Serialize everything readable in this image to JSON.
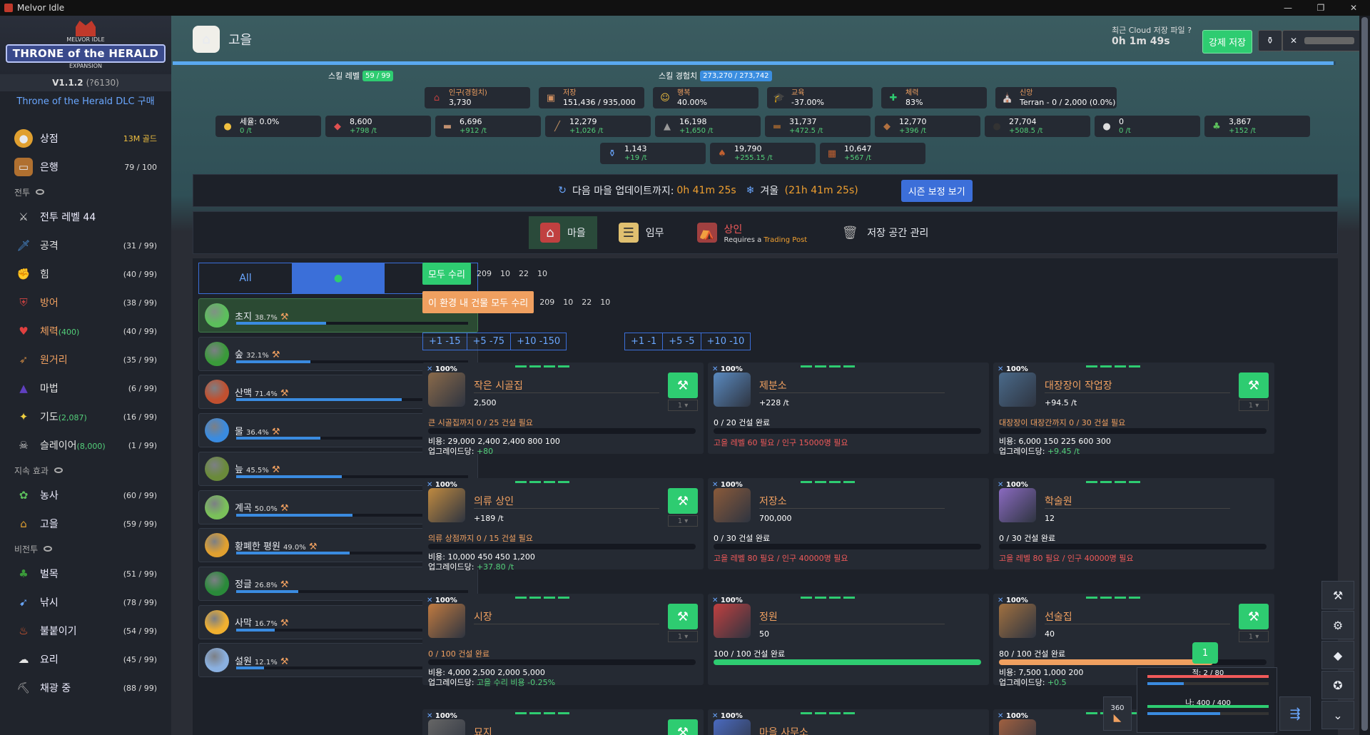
{
  "window": {
    "title": "Melvor Idle"
  },
  "sidebar": {
    "logo": {
      "top": "MELVOR IDLE",
      "title": "THRONE of the HERALD",
      "bottom": "EXPANSION"
    },
    "version": "V1.1.2",
    "version_build": "(?6130)",
    "dlc_link": "Throne of the Herald DLC 구매",
    "shop": {
      "label": "상점",
      "gold": "13M 골드"
    },
    "bank": {
      "label": "은행",
      "count": "79 / 100"
    },
    "cat_combat": "전투",
    "combat_level": "전투 레벨 44",
    "combat_items": [
      {
        "label": "공격",
        "extra": "",
        "level": "(31 / 99)",
        "color": "#e5e5e5"
      },
      {
        "label": "힘",
        "extra": "",
        "level": "(40 / 99)",
        "color": "#e5e5e5"
      },
      {
        "label": "방어",
        "extra": "",
        "level": "(38 / 99)",
        "color": "#f0a060"
      },
      {
        "label": "체력",
        "extra": "(400)",
        "level": "(40 / 99)",
        "color": "#f0a060"
      },
      {
        "label": "원거리",
        "extra": "",
        "level": "(35 / 99)",
        "color": "#f0a060"
      },
      {
        "label": "마법",
        "extra": "",
        "level": "(6 / 99)",
        "color": "#e5e5e5"
      },
      {
        "label": "기도",
        "extra": "(2,087)",
        "level": "(16 / 99)",
        "color": "#e5e5e5"
      },
      {
        "label": "슬레이어",
        "extra": "(8,000)",
        "level": "(1 / 99)",
        "color": "#e5e5e5"
      }
    ],
    "cat_passive": "지속 효과",
    "passive_items": [
      {
        "label": "농사",
        "level": "(60 / 99)"
      },
      {
        "label": "고을",
        "level": "(59 / 99)"
      }
    ],
    "cat_noncombat": "비전투",
    "noncombat_items": [
      {
        "label": "벌목",
        "level": "(51 / 99)"
      },
      {
        "label": "낚시",
        "level": "(78 / 99)"
      },
      {
        "label": "불붙이기",
        "level": "(54 / 99)"
      },
      {
        "label": "요리",
        "level": "(45 / 99)"
      },
      {
        "label": "채광 중",
        "level": "(88 / 99)"
      }
    ]
  },
  "header": {
    "title": "고을",
    "cloud_label": "최근 Cloud 저장 파일",
    "cloud_time": "0h 1m 49s",
    "force_save": "강제 저장"
  },
  "skill": {
    "level_label": "스킬 레벨",
    "level": "59 / 99",
    "xp_label": "스킬 경험치",
    "xp": "273,270 / 273,742",
    "xp_fraction": 0.998
  },
  "stats": [
    {
      "label": "인구(경험치)",
      "value": "3,730",
      "color": "#f0a060"
    },
    {
      "label": "저장",
      "value": "151,436 / 935,000",
      "color": "#f0a060"
    },
    {
      "label": "행복",
      "value": "40.00%",
      "color": "#f0a060"
    },
    {
      "label": "교육",
      "value": "-37.00%",
      "color": "#f0a060"
    },
    {
      "label": "체력",
      "value": "83%",
      "color": "#f0a060"
    },
    {
      "label": "신앙",
      "value": "Terran - 0 / 2,000 (0.0%)",
      "color": "#f0a060"
    }
  ],
  "resources": [
    {
      "name": "gold",
      "value": "세율: 0.0%",
      "rate": "0 /t"
    },
    {
      "name": "food",
      "value": "8,600",
      "rate": "+798 /t"
    },
    {
      "name": "wood",
      "value": "6,696",
      "rate": "+912 /t"
    },
    {
      "name": "planks",
      "value": "12,279",
      "rate": "+1,026 /t"
    },
    {
      "name": "stone",
      "value": "16,198",
      "rate": "+1,650 /t"
    },
    {
      "name": "planks2",
      "value": "31,737",
      "rate": "+472.5 /t"
    },
    {
      "name": "leather",
      "value": "12,770",
      "rate": "+396 /t"
    },
    {
      "name": "coal",
      "value": "27,704",
      "rate": "+508.5 /t"
    },
    {
      "name": "bar",
      "value": "0",
      "rate": "0 /t"
    },
    {
      "name": "herbs",
      "value": "3,867",
      "rate": "+152 /t"
    },
    {
      "name": "potions",
      "value": "1,143",
      "rate": "+19 /t"
    },
    {
      "name": "clothing",
      "value": "19,790",
      "rate": "+255.15 /t"
    },
    {
      "name": "bricks",
      "value": "10,647",
      "rate": "+567 /t"
    }
  ],
  "update": {
    "label": "다음 마을 업데이트까지:",
    "time": "0h 41m 25s",
    "season_label": "겨울",
    "season_time": "(21h 41m 25s)",
    "season_btn": "시즌 보정 보기"
  },
  "tabs": [
    {
      "label": "마을",
      "sub": ""
    },
    {
      "label": "임무",
      "sub": ""
    },
    {
      "label": "상인",
      "sub": "Requires a",
      "sub2": "Trading Post"
    },
    {
      "label": "저장 공간 관리",
      "sub": ""
    }
  ],
  "filter": {
    "all": "All"
  },
  "biomes": [
    {
      "name": "초지",
      "pct": "38.7%",
      "fill": 0.387,
      "color": "#5cbf5c"
    },
    {
      "name": "숲",
      "pct": "32.1%",
      "fill": 0.321,
      "color": "#3a9a3a"
    },
    {
      "name": "산맥",
      "pct": "71.4%",
      "fill": 0.714,
      "color": "#c05030"
    },
    {
      "name": "물",
      "pct": "36.4%",
      "fill": 0.364,
      "color": "#3a8be0"
    },
    {
      "name": "늪",
      "pct": "45.5%",
      "fill": 0.455,
      "color": "#6a8a3a"
    },
    {
      "name": "계곡",
      "pct": "50.0%",
      "fill": 0.5,
      "color": "#7ac05a"
    },
    {
      "name": "황폐한 평원",
      "pct": "49.0%",
      "fill": 0.49,
      "color": "#e0a030"
    },
    {
      "name": "정글",
      "pct": "26.8%",
      "fill": 0.268,
      "color": "#2a8a3a"
    },
    {
      "name": "사막",
      "pct": "16.7%",
      "fill": 0.167,
      "color": "#f0b030"
    },
    {
      "name": "설원",
      "pct": "12.1%",
      "fill": 0.121,
      "color": "#8ab0e0"
    }
  ],
  "repair_all": {
    "label": "모두 수리",
    "costs": [
      "209",
      "10",
      "22",
      "10"
    ]
  },
  "repair_biome": {
    "label": "이 환경 내 건물 모두 수리",
    "costs": [
      "209",
      "10",
      "22",
      "10"
    ]
  },
  "adjust1": [
    "+1  -15",
    "+5  -75",
    "+10  -150"
  ],
  "adjust2": [
    "+1  -1",
    "+5  -5",
    "+10  -10"
  ],
  "cards": [
    {
      "pct": "100%",
      "name": "작은 시골집",
      "stat": "2,500",
      "prog": "큰 시골집까지 0 / 25 건설 필요",
      "fill": 0,
      "cost": "비용: 29,000  2,400  2,400  800  100",
      "upg": "업그레이드당:",
      "upg_v": "+80",
      "req": "",
      "upgrade": true
    },
    {
      "pct": "100%",
      "name": "제분소",
      "stat": "+228 /t",
      "prog": "0 / 20 건설 완료",
      "fill": 0,
      "cost": "",
      "upg": "",
      "upg_v": "",
      "req": "고을 레벨 60 필요 / 인구 15000명 필요",
      "upgrade": false
    },
    {
      "pct": "100%",
      "name": "대장장이 작업장",
      "stat": "+94.5 /t",
      "prog": "대장장이 대장간까지 0 / 30 건설 필요",
      "fill": 0,
      "cost": "비용: 6,000  150  225  600  300",
      "upg": "업그레이드당:",
      "upg_v": "+9.45 /t",
      "req": "",
      "upgrade": true
    },
    {
      "pct": "100%",
      "name": "의류 상인",
      "stat": "+189 /t",
      "prog": "의류 상점까지 0 / 15 건설 필요",
      "fill": 0,
      "cost": "비용: 10,000  450  450  1,200",
      "upg": "업그레이드당:",
      "upg_v": "+37.80 /t",
      "req": "",
      "upgrade": true
    },
    {
      "pct": "100%",
      "name": "저장소",
      "stat": "700,000",
      "prog": "0 / 30 건설 완료",
      "fill": 0,
      "cost": "",
      "upg": "",
      "upg_v": "",
      "req": "고을 레벨 80 필요 / 인구 40000명 필요",
      "upgrade": false
    },
    {
      "pct": "100%",
      "name": "학술원",
      "stat": "12",
      "prog": "0 / 30 건설 완료",
      "fill": 0,
      "cost": "",
      "upg": "",
      "upg_v": "",
      "req": "고을 레벨 80 필요 / 인구 40000명 필요",
      "upgrade": false
    },
    {
      "pct": "100%",
      "name": "시장",
      "stat": "",
      "prog": "0 / 100 건설 완료",
      "fill": 0,
      "cost": "비용: 4,000  2,500  2,000  5,000",
      "upg": "업그레이드당:",
      "upg_v": "고을 수리 비용 -0.25%",
      "req": "",
      "upgrade": true
    },
    {
      "pct": "100%",
      "name": "정원",
      "stat": "50",
      "prog": "100 / 100 건설 완료",
      "fill": 1,
      "cost": "",
      "upg": "",
      "upg_v": "",
      "req": "",
      "upgrade": false
    },
    {
      "pct": "100%",
      "name": "선술집",
      "stat": "40",
      "prog": "80 / 100 건설 완료",
      "fill": 0.8,
      "cost": "비용: 7,500  1,000  200",
      "upg": "업그레이드당:",
      "upg_v": "+0.5",
      "req": "",
      "upgrade": true
    },
    {
      "pct": "100%",
      "name": "묘지",
      "stat": "",
      "prog": "",
      "fill": 0,
      "cost": "",
      "upg": "",
      "upg_v": "",
      "req": "",
      "upgrade": true
    },
    {
      "pct": "100%",
      "name": "마을 사무소",
      "stat": "",
      "prog": "",
      "fill": 0,
      "cost": "",
      "upg": "",
      "upg_v": "",
      "req": "",
      "upgrade": false
    },
    {
      "pct": "100%",
      "name": "",
      "stat": "",
      "prog": "",
      "fill": 0,
      "cost": "",
      "upg": "",
      "upg_v": "",
      "req": "",
      "upgrade": false
    }
  ],
  "combat": {
    "enemy": "적: 2 / 80",
    "player": "나: 400 / 400",
    "food": "360",
    "badge": "1"
  }
}
